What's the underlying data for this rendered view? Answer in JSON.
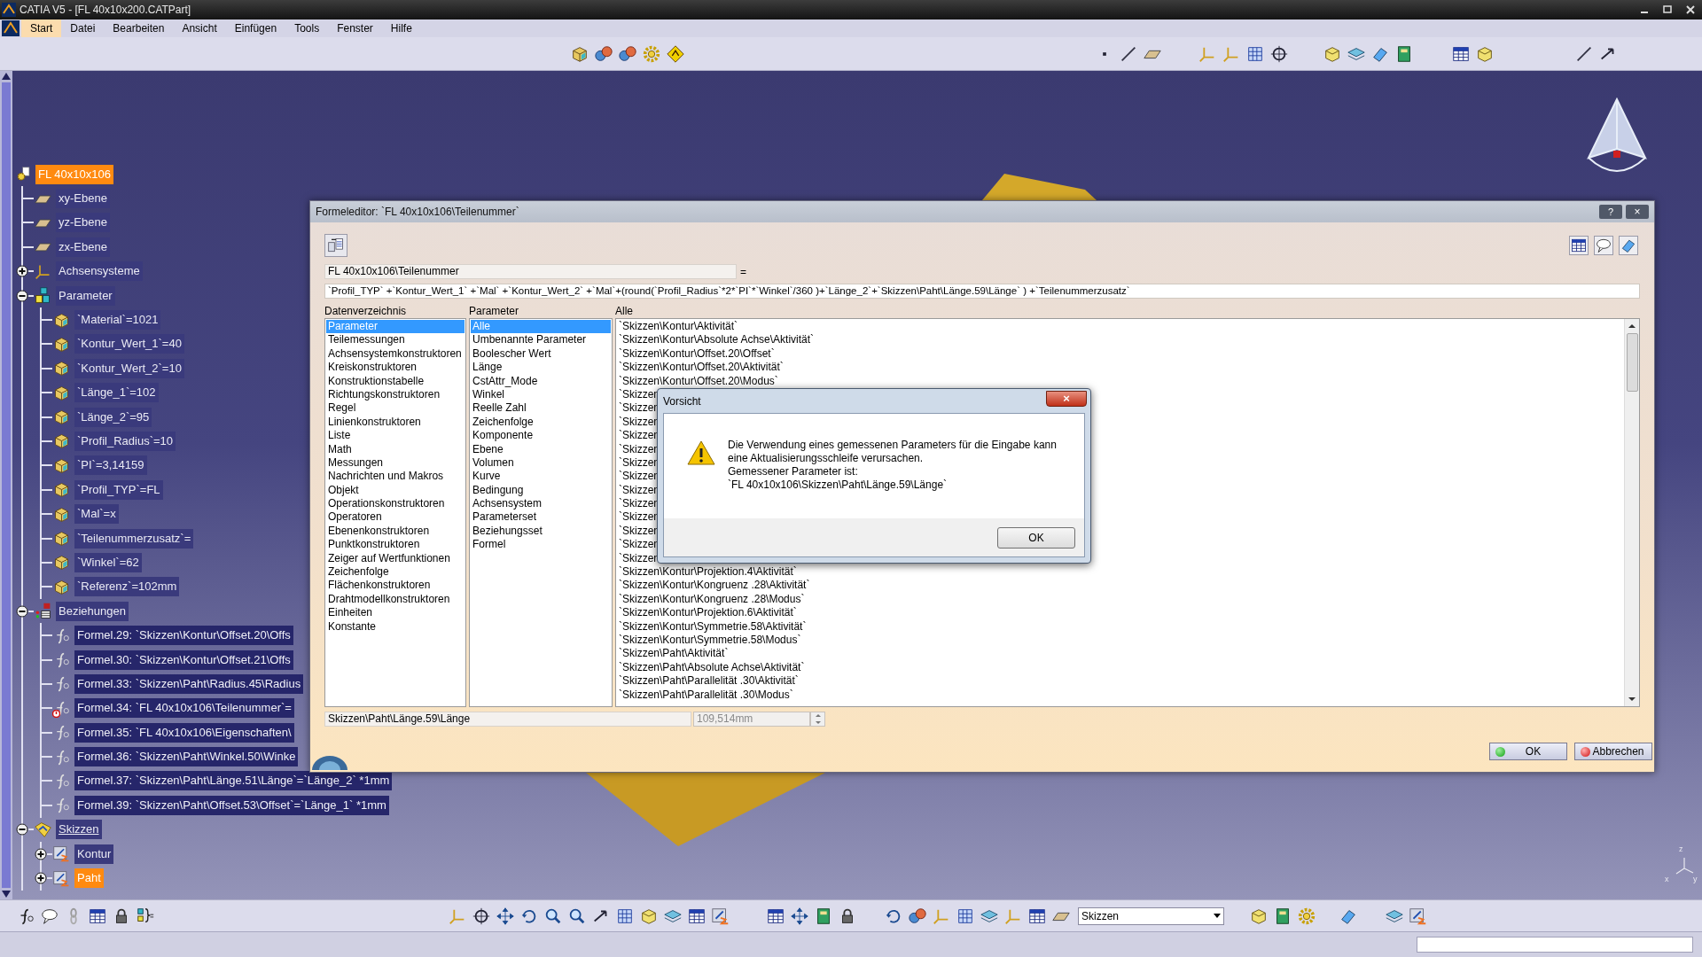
{
  "window": {
    "title": "CATIA V5 - [FL 40x10x200.CATPart]"
  },
  "menu": [
    {
      "label": "Start",
      "selected": true
    },
    {
      "label": "Datei",
      "selected": false
    },
    {
      "label": "Bearbeiten",
      "selected": false
    },
    {
      "label": "Ansicht",
      "selected": false
    },
    {
      "label": "Einfügen",
      "selected": false
    },
    {
      "label": "Tools",
      "selected": false
    },
    {
      "label": "Fenster",
      "selected": false
    },
    {
      "label": "Hilfe",
      "selected": false
    }
  ],
  "tree": {
    "label": "FL 40x10x106",
    "kind": "part",
    "selected": true,
    "current": false,
    "children": [
      {
        "label": "xy-Ebene",
        "kind": "plane",
        "selected": false,
        "current": false
      },
      {
        "label": "yz-Ebene",
        "kind": "plane",
        "selected": false,
        "current": false
      },
      {
        "label": "zx-Ebene",
        "kind": "plane",
        "selected": false,
        "current": false
      },
      {
        "label": "Achsensysteme",
        "kind": "axes",
        "selected": false,
        "current": false,
        "expanded": false
      },
      {
        "label": "Parameter",
        "kind": "parameters",
        "selected": false,
        "current": false,
        "expanded": true,
        "children": [
          {
            "label": "`Material`=1021",
            "kind": "parameter",
            "selected": false,
            "current": false
          },
          {
            "label": "`Kontur_Wert_1`=40",
            "kind": "parameter",
            "selected": false,
            "current": false
          },
          {
            "label": "`Kontur_Wert_2`=10",
            "kind": "parameter",
            "selected": false,
            "current": false
          },
          {
            "label": "`Länge_1`=102",
            "kind": "parameter",
            "selected": false,
            "current": false
          },
          {
            "label": "`Länge_2`=95",
            "kind": "parameter",
            "selected": false,
            "current": false
          },
          {
            "label": "`Profil_Radius`=10",
            "kind": "parameter",
            "selected": false,
            "current": false
          },
          {
            "label": "`PI`=3,14159",
            "kind": "parameter",
            "selected": false,
            "current": false
          },
          {
            "label": "`Profil_TYP`=FL",
            "kind": "parameter",
            "selected": false,
            "current": false
          },
          {
            "label": "`Mal`=x",
            "kind": "parameter",
            "selected": false,
            "current": false
          },
          {
            "label": "`Teilenummerzusatz`=",
            "kind": "parameter",
            "selected": false,
            "current": false
          },
          {
            "label": "`Winkel`=62",
            "kind": "parameter",
            "selected": false,
            "current": false
          },
          {
            "label": "`Referenz`=102mm",
            "kind": "parameter",
            "selected": false,
            "current": false
          }
        ]
      },
      {
        "label": "Beziehungen",
        "kind": "relations",
        "selected": false,
        "current": false,
        "expanded": true,
        "children": [
          {
            "label": "Formel.29: `Skizzen\\Kontur\\Offset.20\\Offs",
            "kind": "formula",
            "selected": false,
            "current": false,
            "error": false
          },
          {
            "label": "Formel.30: `Skizzen\\Kontur\\Offset.21\\Offs",
            "kind": "formula",
            "selected": false,
            "current": false,
            "error": false
          },
          {
            "label": "Formel.33: `Skizzen\\Paht\\Radius.45\\Radius",
            "kind": "formula",
            "selected": false,
            "current": false,
            "error": false
          },
          {
            "label": "Formel.34: `FL 40x10x106\\Teilenummer`=",
            "kind": "formula",
            "selected": false,
            "current": false,
            "error": true
          },
          {
            "label": "Formel.35: `FL 40x10x106\\Eigenschaften\\",
            "kind": "formula",
            "selected": false,
            "current": false,
            "error": false
          },
          {
            "label": "Formel.36: `Skizzen\\Paht\\Winkel.50\\Winke",
            "kind": "formula",
            "selected": false,
            "current": false,
            "error": false
          },
          {
            "label": "Formel.37: `Skizzen\\Paht\\Länge.51\\Länge`=`Länge_2` *1mm",
            "kind": "formula",
            "selected": false,
            "current": false,
            "error": false
          },
          {
            "label": "Formel.39: `Skizzen\\Paht\\Offset.53\\Offset`=`Länge_1` *1mm",
            "kind": "formula",
            "selected": false,
            "current": false,
            "error": false
          }
        ]
      },
      {
        "label": "Skizzen",
        "kind": "sketches",
        "selected": false,
        "current": true,
        "expanded": true,
        "children": [
          {
            "label": "Kontur",
            "kind": "sketch",
            "selected": false,
            "current": false,
            "expanded": false
          },
          {
            "label": "Paht",
            "kind": "sketch",
            "selected": true,
            "current": false,
            "expanded": false
          }
        ]
      }
    ]
  },
  "viewport": {
    "axis_labels": [
      "x",
      "y",
      "z"
    ]
  },
  "formula_editor": {
    "title": "Formeleditor:  `FL 40x10x106\\Teilenummer`",
    "help": "?",
    "close": "×",
    "target": "FL 40x10x106\\Teilenummer",
    "equals": "=",
    "formula": "`Profil_TYP` +`Kontur_Wert_1` +`Mal` +`Kontur_Wert_2` +`Mal`+(round(`Profil_Radius`*2*`PI`*`Winkel`/360 )+`Länge_2`+`Skizzen\\Paht\\Länge.59\\Länge` ) +`Teilenummerzusatz`",
    "columns": [
      "Datenverzeichnis",
      "Parameter",
      "Alle"
    ],
    "directory": [
      {
        "label": "Parameter",
        "selected": true
      },
      {
        "label": "Teilemessungen",
        "selected": false
      },
      {
        "label": "Achsensystemkonstruktoren",
        "selected": false
      },
      {
        "label": "Kreiskonstruktoren",
        "selected": false
      },
      {
        "label": "Konstruktionstabelle",
        "selected": false
      },
      {
        "label": "Richtungskonstruktoren",
        "selected": false
      },
      {
        "label": "Regel",
        "selected": false
      },
      {
        "label": "Linienkonstruktoren",
        "selected": false
      },
      {
        "label": "Liste",
        "selected": false
      },
      {
        "label": "Math",
        "selected": false
      },
      {
        "label": "Messungen",
        "selected": false
      },
      {
        "label": "Nachrichten und Makros",
        "selected": false
      },
      {
        "label": "Objekt",
        "selected": false
      },
      {
        "label": "Operationskonstruktoren",
        "selected": false
      },
      {
        "label": "Operatoren",
        "selected": false
      },
      {
        "label": "Ebenenkonstruktoren",
        "selected": false
      },
      {
        "label": "Punktkonstruktoren",
        "selected": false
      },
      {
        "label": "Zeiger auf Wertfunktionen",
        "selected": false
      },
      {
        "label": "Zeichenfolge",
        "selected": false
      },
      {
        "label": "Flächenkonstruktoren",
        "selected": false
      },
      {
        "label": "Drahtmodellkonstruktoren",
        "selected": false
      },
      {
        "label": "Einheiten",
        "selected": false
      },
      {
        "label": "Konstante",
        "selected": false
      }
    ],
    "parameter_types": [
      {
        "label": "Alle",
        "selected": true
      },
      {
        "label": "Umbenannte Parameter",
        "selected": false
      },
      {
        "label": "Boolescher Wert",
        "selected": false
      },
      {
        "label": "Länge",
        "selected": false
      },
      {
        "label": "CstAttr_Mode",
        "selected": false
      },
      {
        "label": "Winkel",
        "selected": false
      },
      {
        "label": "Reelle Zahl",
        "selected": false
      },
      {
        "label": "Zeichenfolge",
        "selected": false
      },
      {
        "label": "Komponente",
        "selected": false
      },
      {
        "label": "Ebene",
        "selected": false
      },
      {
        "label": "Volumen",
        "selected": false
      },
      {
        "label": "Kurve",
        "selected": false
      },
      {
        "label": "Bedingung",
        "selected": false
      },
      {
        "label": "Achsensystem",
        "selected": false
      },
      {
        "label": "Parameterset",
        "selected": false
      },
      {
        "label": "Beziehungsset",
        "selected": false
      },
      {
        "label": "Formel",
        "selected": false
      }
    ],
    "members": [
      "`Skizzen\\Kontur\\Aktivität`",
      "`Skizzen\\Kontur\\Absolute Achse\\Aktivität`",
      "`Skizzen\\Kontur\\Offset.20\\Offset`",
      "`Skizzen\\Kontur\\Offset.20\\Aktivität`",
      "`Skizzen\\Kontur\\Offset.20\\Modus`",
      "`Skizzen",
      "`Skizzen",
      "`Skizzen",
      "`Skizzen",
      "`Skizzen",
      "`Skizzen",
      "`Skizzen",
      "`Skizzen",
      "`Skizzen",
      "`Skizzen",
      "`Skizzen",
      "`Skizzen",
      "`Skizzen",
      "`Skizzen\\Kontur\\Projektion.4\\Aktivität`",
      "`Skizzen\\Kontur\\Kongruenz .28\\Aktivität`",
      "`Skizzen\\Kontur\\Kongruenz .28\\Modus`",
      "`Skizzen\\Kontur\\Projektion.6\\Aktivität`",
      "`Skizzen\\Kontur\\Symmetrie.58\\Aktivität`",
      "`Skizzen\\Kontur\\Symmetrie.58\\Modus`",
      "`Skizzen\\Paht\\Aktivität`",
      "`Skizzen\\Paht\\Absolute Achse\\Aktivität`",
      "`Skizzen\\Paht\\Parallelität .30\\Aktivität`",
      "`Skizzen\\Paht\\Parallelität .30\\Modus`"
    ],
    "measured_path": "Skizzen\\Paht\\Länge.59\\Länge",
    "value": "109,514mm",
    "value_disabled": true,
    "buttons": [
      {
        "label": "OK",
        "kind": "ok"
      },
      {
        "label": "Abbrechen",
        "kind": "cancel"
      }
    ]
  },
  "warning_dialog": {
    "title": "Vorsicht",
    "close": "×",
    "message": [
      "Die Verwendung eines gemessenen Parameters für die Eingabe kann",
      "eine Aktualisierungsschleife verursachen.",
      "Gemessener Parameter ist:",
      "`FL 40x10x106\\Skizzen\\Paht\\Länge.59\\Länge`"
    ],
    "button": "OK"
  },
  "bottom_toolbar": {
    "workbench": "Skizzen"
  }
}
